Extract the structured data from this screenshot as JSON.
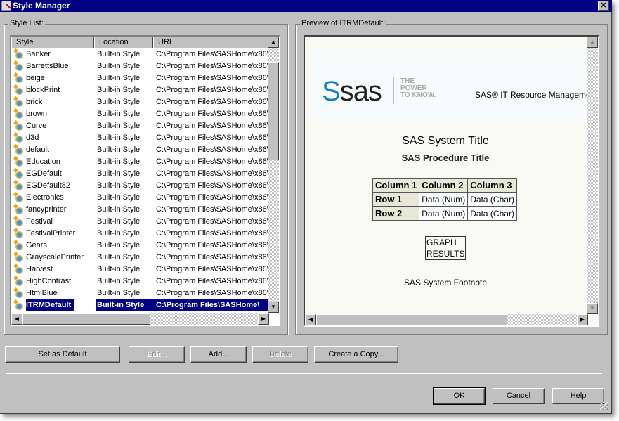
{
  "window": {
    "title": "Style Manager",
    "close_label": "✕"
  },
  "style_list": {
    "label": "Style List:",
    "columns": [
      "Style",
      "Location",
      "URL"
    ],
    "rows": [
      {
        "style": "Banker",
        "location": "Built-in Style",
        "url": "C:\\Program Files\\SASHome\\x86\\S"
      },
      {
        "style": "BarrettsBlue",
        "location": "Built-in Style",
        "url": "C:\\Program Files\\SASHome\\x86\\S"
      },
      {
        "style": "beige",
        "location": "Built-in Style",
        "url": "C:\\Program Files\\SASHome\\x86\\S"
      },
      {
        "style": "blockPrint",
        "location": "Built-in Style",
        "url": "C:\\Program Files\\SASHome\\x86\\S"
      },
      {
        "style": "brick",
        "location": "Built-in Style",
        "url": "C:\\Program Files\\SASHome\\x86\\S"
      },
      {
        "style": "brown",
        "location": "Built-in Style",
        "url": "C:\\Program Files\\SASHome\\x86\\S"
      },
      {
        "style": "Curve",
        "location": "Built-in Style",
        "url": "C:\\Program Files\\SASHome\\x86\\S"
      },
      {
        "style": "d3d",
        "location": "Built-in Style",
        "url": "C:\\Program Files\\SASHome\\x86\\S"
      },
      {
        "style": "default",
        "location": "Built-in Style",
        "url": "C:\\Program Files\\SASHome\\x86\\S"
      },
      {
        "style": "Education",
        "location": "Built-in Style",
        "url": "C:\\Program Files\\SASHome\\x86\\S"
      },
      {
        "style": "EGDefault",
        "location": "Built-in Style",
        "url": "C:\\Program Files\\SASHome\\x86\\S"
      },
      {
        "style": "EGDefault82",
        "location": "Built-in Style",
        "url": "C:\\Program Files\\SASHome\\x86\\S"
      },
      {
        "style": "Electronics",
        "location": "Built-in Style",
        "url": "C:\\Program Files\\SASHome\\x86\\S"
      },
      {
        "style": "fancyprinter",
        "location": "Built-in Style",
        "url": "C:\\Program Files\\SASHome\\x86\\S"
      },
      {
        "style": "Festival",
        "location": "Built-in Style",
        "url": "C:\\Program Files\\SASHome\\x86\\S"
      },
      {
        "style": "FestivalPrinter",
        "location": "Built-in Style",
        "url": "C:\\Program Files\\SASHome\\x86\\S"
      },
      {
        "style": "Gears",
        "location": "Built-in Style",
        "url": "C:\\Program Files\\SASHome\\x86\\S"
      },
      {
        "style": "GrayscalePrinter",
        "location": "Built-in Style",
        "url": "C:\\Program Files\\SASHome\\x86\\S"
      },
      {
        "style": "Harvest",
        "location": "Built-in Style",
        "url": "C:\\Program Files\\SASHome\\x86\\S"
      },
      {
        "style": "HighContrast",
        "location": "Built-in Style",
        "url": "C:\\Program Files\\SASHome\\x86\\S"
      },
      {
        "style": "HtmlBlue",
        "location": "Built-in Style",
        "url": "C:\\Program Files\\SASHome\\x86\\S"
      },
      {
        "style": "ITRMDefault",
        "location": "Built-in Style",
        "url": "C:\\Program Files\\SASHome\\",
        "selected": true
      }
    ]
  },
  "preview": {
    "label": "Preview of ITRMDefault:",
    "logo_text": "sas",
    "tagline": [
      "THE",
      "POWER",
      "TO KNOW."
    ],
    "banner_text": "SAS® IT Resource Manageme",
    "system_title": "SAS System Title",
    "procedure_title": "SAS Procedure Title",
    "table": {
      "headers": [
        "Column 1",
        "Column 2",
        "Column 3"
      ],
      "rows": [
        [
          "Row 1",
          "Data (Num)",
          "Data (Char)"
        ],
        [
          "Row 2",
          "Data (Num)",
          "Data (Char)"
        ]
      ]
    },
    "graph_lines": [
      "GRAPH",
      "RESULTS"
    ],
    "footnote": "SAS System Footnote"
  },
  "buttons": {
    "set_default": "Set as Default",
    "edit": "Edit...",
    "add": "Add...",
    "delete": "Delete",
    "copy": "Create a Copy...",
    "ok": "OK",
    "cancel": "Cancel",
    "help": "Help"
  },
  "colors": {
    "titlebar": "#000080",
    "selection": "#000080",
    "face": "#c0c0c0"
  }
}
